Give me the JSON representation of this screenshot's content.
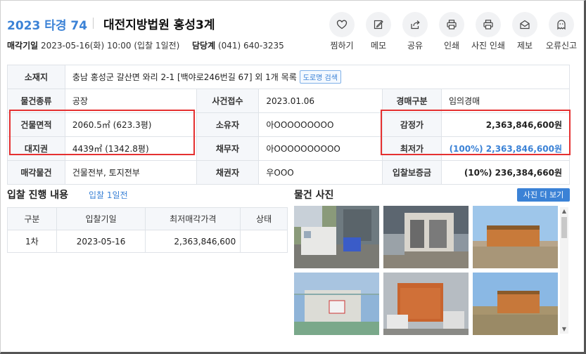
{
  "header": {
    "case_no": "2023 타경 74",
    "court": "대전지방법원 홍성3계",
    "sale_date_label": "매각기일",
    "sale_date_value": "2023-05-16(화) 10:00 (입찰 1일전)",
    "dept_label": "담당계",
    "dept_value": "(041) 640-3235"
  },
  "actions": [
    {
      "label": "찜하기",
      "icon": "heart-icon"
    },
    {
      "label": "메모",
      "icon": "memo-icon"
    },
    {
      "label": "공유",
      "icon": "share-icon"
    },
    {
      "label": "인쇄",
      "icon": "print-icon"
    },
    {
      "label": "사진 인쇄",
      "icon": "photo-print-icon"
    },
    {
      "label": "제보",
      "icon": "mail-icon"
    },
    {
      "label": "오류신고",
      "icon": "ghost-icon"
    }
  ],
  "info": {
    "location_label": "소재지",
    "location_value": "충남 홍성군 갈산면 와리 2-1 [백야로246번길 67] 외 1개 목록",
    "road_btn": "도로명 검색",
    "type_label": "물건종류",
    "type_value": "공장",
    "received_label": "사건접수",
    "received_value": "2023.01.06",
    "auction_type_label": "경매구분",
    "auction_type_value": "임의경매",
    "building_area_label": "건물면적",
    "building_area_value": "2060.5㎡ (623.3평)",
    "owner_label": "소유자",
    "owner_value": "아OOOOOOOOO",
    "appraisal_label": "감정가",
    "appraisal_value": "2,363,846,600원",
    "land_label": "대지권",
    "land_value": "4439㎡ (1342.8평)",
    "debtor_label": "채무자",
    "debtor_value": "아OOOOOOOOOO",
    "min_price_label": "최저가",
    "min_price_value": "(100%) 2,363,846,600원",
    "sale_items_label": "매각물건",
    "sale_items_value": "건물전부, 토지전부",
    "creditor_label": "채권자",
    "creditor_value": "우OOO",
    "deposit_label": "입찰보증금",
    "deposit_value": "(10%) 236,384,660원"
  },
  "bid": {
    "title": "입찰 진행 내용",
    "link": "입찰 1일전",
    "headers": [
      "구분",
      "입찰기일",
      "최저매각가격",
      "상태"
    ],
    "rows": [
      [
        "1차",
        "2023-05-16",
        "2,363,846,600",
        ""
      ]
    ]
  },
  "photos": {
    "title": "물건 사진",
    "more_btn": "사진 더 보기"
  },
  "colors": {
    "accent": "#3b82d6",
    "highlight_box": "#e53030",
    "header_cell_bg": "#f5f7fa"
  }
}
